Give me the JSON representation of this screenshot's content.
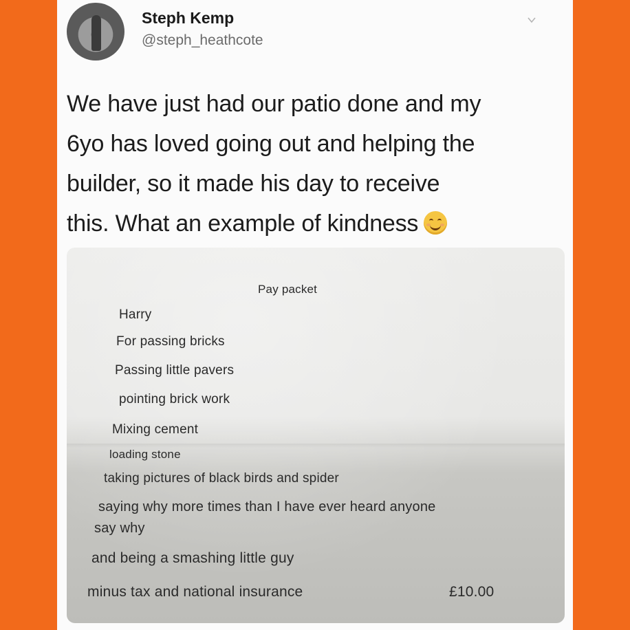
{
  "tweet": {
    "author_name": "Steph Kemp",
    "author_handle": "@steph_heathcote",
    "text_lines": [
      "We have just had our patio done and my",
      "6yo has loved going out and helping the",
      "builder, so it made his day to receive",
      "this. What an example of kindness"
    ],
    "emoji": "smiling-face-emoji",
    "menu_icon": "chevron-down-icon"
  },
  "note": {
    "title": "Pay packet",
    "lines": [
      "Harry",
      "For passing bricks",
      "Passing little pavers",
      "pointing brick work",
      "Mixing cement",
      "loading stone",
      "taking pictures of black birds and spider",
      "saying why more times than I have ever heard anyone",
      "say why",
      "and being a smashing little guy",
      "minus tax and national insurance"
    ],
    "amount": "£10.00"
  },
  "colors": {
    "frame": "#f26a1b",
    "card": "#fbfbfb"
  }
}
